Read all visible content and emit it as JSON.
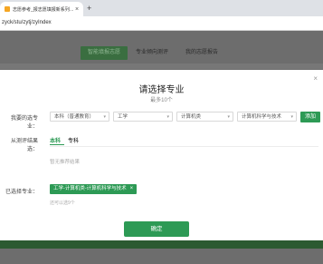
{
  "browser": {
    "tab_title": "志愿参考_报志愿填报新系列…",
    "tab_close": "×",
    "new_tab": "+",
    "url": "zyck/stu/zytj/zyIndex"
  },
  "background_nav": {
    "items": [
      "智能填报志愿",
      "专业倾向测评",
      "我的志愿报告"
    ]
  },
  "modal": {
    "title": "请选择专业",
    "subtitle": "最多10个",
    "close": "×",
    "filter_label": "我要的选专业：",
    "selects": [
      {
        "value": "本科（普通教育）"
      },
      {
        "value": "工学"
      },
      {
        "value": "计算机类"
      },
      {
        "value": "计算机科学与技术"
      }
    ],
    "add_label": "添加",
    "from_label": "从测评结果选：",
    "tabs": [
      "本科",
      "专科"
    ],
    "empty_text": "暂无推荐结果",
    "selected_label": "已选择专业：",
    "selected_tag": "工学-计算机类-计算机科学与技术",
    "tag_close": "×",
    "hint": "还可以选9个",
    "confirm_label": "确定"
  },
  "colors": {
    "accent": "#2d9a55",
    "overlay": "#6d6d6d"
  }
}
